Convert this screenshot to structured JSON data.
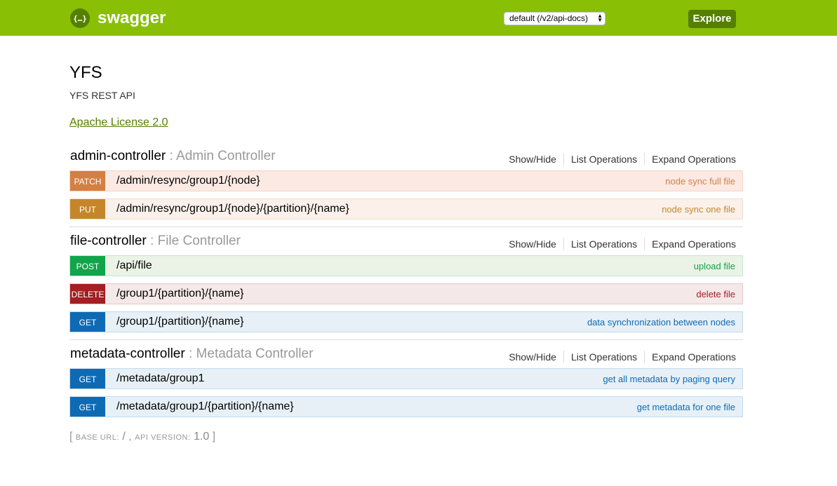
{
  "header": {
    "logo_icon_text": "{…}",
    "logo_text": "swagger",
    "spec_select_value": "default (/v2/api-docs)",
    "explore_label": "Explore",
    "background_color": "#89bf04",
    "accent_color": "#547f00"
  },
  "info": {
    "title": "YFS",
    "description": "YFS REST API",
    "license": "Apache License 2.0"
  },
  "resource_actions": {
    "show_hide": "Show/Hide",
    "list_operations": "List Operations",
    "expand_operations": "Expand Operations"
  },
  "resources": [
    {
      "name": "admin-controller",
      "separator": " : ",
      "description": "Admin Controller",
      "operations": [
        {
          "method": "PATCH",
          "path": "/admin/resync/group1/{node}",
          "summary": "node sync full file"
        },
        {
          "method": "PUT",
          "path": "/admin/resync/group1/{node}/{partition}/{name}",
          "summary": "node sync one file"
        }
      ]
    },
    {
      "name": "file-controller",
      "separator": " : ",
      "description": "File Controller",
      "operations": [
        {
          "method": "POST",
          "path": "/api/file",
          "summary": "upload file"
        },
        {
          "method": "DELETE",
          "path": "/group1/{partition}/{name}",
          "summary": "delete file"
        },
        {
          "method": "GET",
          "path": "/group1/{partition}/{name}",
          "summary": "data synchronization between nodes"
        }
      ]
    },
    {
      "name": "metadata-controller",
      "separator": " : ",
      "description": "Metadata Controller",
      "operations": [
        {
          "method": "GET",
          "path": "/metadata/group1",
          "summary": "get all metadata by paging query"
        },
        {
          "method": "GET",
          "path": "/metadata/group1/{partition}/{name}",
          "summary": "get metadata for one file"
        }
      ]
    }
  ],
  "footer": {
    "open_bracket": "[",
    "base_url_label": "base url",
    "base_url_value": "/",
    "api_version_label": "api version",
    "api_version_value": "1.0",
    "close_bracket": "]"
  }
}
